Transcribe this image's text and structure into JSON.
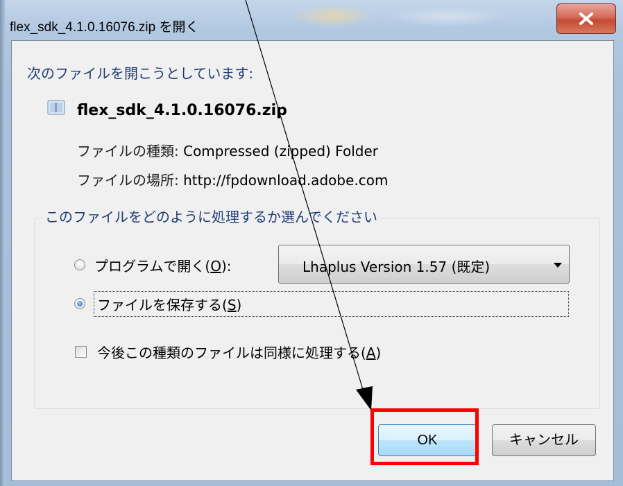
{
  "window": {
    "title": "flex_sdk_4.1.0.16076.zip を開く",
    "close_icon": "close-icon"
  },
  "dialog": {
    "prompt": "次のファイルを開こうとしています:",
    "file_icon": "zip-folder-icon",
    "file_name": "flex_sdk_4.1.0.16076.zip",
    "type_label": "ファイルの種類:",
    "type_value": "Compressed (zipped) Folder",
    "location_label": "ファイルの場所:",
    "location_value": "http://fpdownload.adobe.com"
  },
  "action_group": {
    "legend": "このファイルをどのように処理するか選んでください",
    "open_with": {
      "label_before": "プログラムで開く(",
      "accel": "O",
      "label_after": "):",
      "checked": false
    },
    "program_select": {
      "selected": "Lhaplus Version 1.57 (既定)"
    },
    "save_file": {
      "label_before": "ファイルを保存する(",
      "accel": "S",
      "label_after": ")",
      "checked": true
    },
    "remember": {
      "label_before": "今後この種類のファイルは同様に処理する(",
      "accel": "A",
      "label_after": ")",
      "checked": false
    }
  },
  "buttons": {
    "ok": "OK",
    "cancel": "キャンセル"
  },
  "annotation": {
    "highlight_color": "#ff0000",
    "arrow_color": "#000000"
  }
}
